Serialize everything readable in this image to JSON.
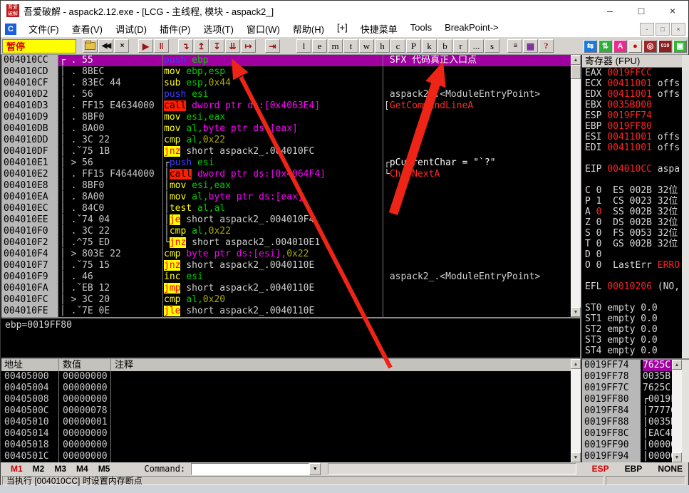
{
  "colors": {
    "selection_purple": "#a000a0",
    "value_red": "#ff2222",
    "pause_yellow": "#ffff00",
    "annotation_red": "#ee2417"
  },
  "window": {
    "title": "吾爱破解 - aspack2.12.exe - [LCG -  主线程, 模块 - aspack2_]",
    "controls": [
      "–",
      "□",
      "×"
    ]
  },
  "menu": {
    "items": [
      "文件(F)",
      "查看(V)",
      "调试(D)",
      "插件(P)",
      "选项(T)",
      "窗口(W)",
      "帮助(H)",
      "[+]",
      "快捷菜单",
      "Tools",
      "BreakPoint->"
    ],
    "mdi_controls": [
      "-",
      "□",
      "×"
    ]
  },
  "toolbar": {
    "pause_label": "暂停",
    "nav": [
      {
        "g": "",
        "cls": "b-folder"
      },
      {
        "g": "◀◀",
        "cls": "b-blk"
      },
      {
        "g": "×",
        "cls": "b-blk"
      },
      {
        "sp": 1
      },
      {
        "g": "▶",
        "cls": "b-red"
      },
      {
        "g": "‖",
        "cls": "b-red"
      },
      {
        "sp": 1
      },
      {
        "g": "↴",
        "cls": "b-red"
      },
      {
        "g": "↥",
        "cls": "b-red"
      },
      {
        "g": "↧",
        "cls": "b-red"
      },
      {
        "g": "⇊",
        "cls": "b-red"
      },
      {
        "g": "↦",
        "cls": "b-red"
      },
      {
        "sp": 1
      },
      {
        "g": "⇥",
        "cls": "b-red"
      },
      {
        "sp": 1
      }
    ],
    "letters": [
      "l",
      "e",
      "m",
      "t",
      "w",
      "h",
      "c",
      "P",
      "k",
      "b",
      "r",
      "...",
      "s"
    ],
    "tail": [
      {
        "g": "≡",
        "cls": "b-blk"
      },
      {
        "g": "▦",
        "cls": "b-pur"
      },
      {
        "g": "?",
        "cls": "b-q"
      }
    ],
    "right_icons": [
      {
        "name": "sync-icon",
        "g": "⇆",
        "bg": "#1f7ae0",
        "fg": "#fff"
      },
      {
        "name": "swap-icon",
        "g": "⇅",
        "bg": "#2fae3e",
        "fg": "#fff"
      },
      {
        "name": "a-icon",
        "g": "A",
        "bg": "#ee2a90",
        "fg": "#fff"
      },
      {
        "name": "record-icon",
        "g": "●",
        "bg": "#e8e4dc",
        "fg": "#d00000"
      },
      {
        "name": "target-icon",
        "g": "◎",
        "bg": "#a02828",
        "fg": "#fff"
      },
      {
        "name": "binary-icon",
        "g": "010",
        "bg": "#8a1f1f",
        "fg": "#fff"
      },
      {
        "name": "window-icon",
        "g": "▣",
        "bg": "#35b43a",
        "fg": "#fff"
      }
    ]
  },
  "disasm": {
    "rows": [
      {
        "a": "004010CC",
        "m": "┌ .",
        "h": "55",
        "o": [
          [
            "mB",
            "push"
          ],
          [
            "rG",
            " ebp"
          ]
        ],
        "c": [
          [
            "cw",
            " SFX 代码真正入口点"
          ]
        ],
        "s": 1
      },
      {
        "a": "004010CD",
        "m": "│ .",
        "h": "8BEC",
        "o": [
          [
            "mY",
            "mov"
          ],
          [
            "rG",
            " ebp,esp"
          ]
        ]
      },
      {
        "a": "004010CF",
        "m": "│ .",
        "h": "83EC 44",
        "o": [
          [
            "mY",
            "sub"
          ],
          [
            "rG",
            " esp,"
          ],
          [
            "iO",
            "0x44"
          ]
        ]
      },
      {
        "a": "004010D2",
        "m": "│ .",
        "h": "56",
        "o": [
          [
            "mB",
            "push"
          ],
          [
            "rG",
            " esi"
          ]
        ],
        "c": [
          [
            "tW",
            " aspack2_.<ModuleEntryPoint>"
          ]
        ]
      },
      {
        "a": "004010D3",
        "m": "│ .",
        "h": "FF15 E4634000",
        "o": [
          [
            "mC",
            "call"
          ],
          [
            "mM",
            " dword ptr ds:[0x4063E4]"
          ]
        ],
        "c": [
          [
            "tW",
            "["
          ],
          [
            "cr",
            "GetCommandLineA"
          ]
        ]
      },
      {
        "a": "004010D9",
        "m": "│ .",
        "h": "8BF0",
        "o": [
          [
            "mY",
            "mov"
          ],
          [
            "rG",
            " esi,eax"
          ]
        ]
      },
      {
        "a": "004010DB",
        "m": "│ .",
        "h": "8A00",
        "o": [
          [
            "mY",
            "mov"
          ],
          [
            "rG",
            " al,"
          ],
          [
            "mM",
            "byte ptr ds:[eax]"
          ]
        ]
      },
      {
        "a": "004010DD",
        "m": "│ .",
        "h": "3C 22",
        "o": [
          [
            "mY",
            "cmp"
          ],
          [
            "rG",
            " al,"
          ],
          [
            "iO",
            "0x22"
          ]
        ]
      },
      {
        "a": "004010DF",
        "m": "│ .ˇ",
        "h": "75 1B",
        "o": [
          [
            "mJ",
            "jnz"
          ],
          [
            "tW",
            " short aspack2_.004010FC"
          ]
        ]
      },
      {
        "a": "004010E1",
        "m": "│ >",
        "h": "56",
        "o": [
          [
            "tW",
            "┌"
          ],
          [
            "mB",
            "push"
          ],
          [
            "rG",
            " esi"
          ]
        ],
        "c": [
          [
            "tW",
            "┌"
          ],
          [
            "cw",
            "pCurrentChar = \"`?\""
          ]
        ]
      },
      {
        "a": "004010E2",
        "m": "│ .",
        "h": "FF15 F4644000",
        "o": [
          [
            "tW",
            "│"
          ],
          [
            "mC",
            "call"
          ],
          [
            "mM",
            " dword ptr ds:[0x4064F4]"
          ]
        ],
        "c": [
          [
            "tW",
            "└"
          ],
          [
            "cr",
            "CharNextA"
          ]
        ]
      },
      {
        "a": "004010E8",
        "m": "│ .",
        "h": "8BF0",
        "o": [
          [
            "tW",
            "│"
          ],
          [
            "mY",
            "mov"
          ],
          [
            "rG",
            " esi,eax"
          ]
        ]
      },
      {
        "a": "004010EA",
        "m": "│ .",
        "h": "8A00",
        "o": [
          [
            "tW",
            "│"
          ],
          [
            "mY",
            "mov"
          ],
          [
            "rG",
            " al,"
          ],
          [
            "mM",
            "byte ptr ds:[eax]"
          ]
        ]
      },
      {
        "a": "004010EC",
        "m": "│ .",
        "h": "84C0",
        "o": [
          [
            "tW",
            "│"
          ],
          [
            "mY",
            "test"
          ],
          [
            "rG",
            " al,al"
          ]
        ]
      },
      {
        "a": "004010EE",
        "m": "│ .ˇ",
        "h": "74 04",
        "o": [
          [
            "tW",
            "│"
          ],
          [
            "mJ",
            "je"
          ],
          [
            "tW",
            " short aspack2_.004010F4"
          ]
        ]
      },
      {
        "a": "004010F0",
        "m": "│ .",
        "h": "3C 22",
        "o": [
          [
            "tW",
            "│"
          ],
          [
            "mY",
            "cmp"
          ],
          [
            "rG",
            " al,"
          ],
          [
            "iO",
            "0x22"
          ]
        ]
      },
      {
        "a": "004010F2",
        "m": "│ .^",
        "h": "75 ED",
        "o": [
          [
            "tW",
            "└"
          ],
          [
            "mJ",
            "jnz"
          ],
          [
            "tW",
            " short aspack2_.004010E1"
          ]
        ]
      },
      {
        "a": "004010F4",
        "m": "│ >",
        "h": "803E 22",
        "o": [
          [
            "mY",
            "cmp"
          ],
          [
            "mM",
            " byte ptr ds:[esi],"
          ],
          [
            "iO",
            "0x22"
          ]
        ]
      },
      {
        "a": "004010F7",
        "m": "│ .ˇ",
        "h": "75 15",
        "o": [
          [
            "mJ",
            "jnz"
          ],
          [
            "tW",
            " short aspack2_.0040110E"
          ]
        ]
      },
      {
        "a": "004010F9",
        "m": "│ .",
        "h": "46",
        "o": [
          [
            "mY",
            "inc"
          ],
          [
            "rG",
            " esi"
          ]
        ],
        "c": [
          [
            "tW",
            " aspack2_.<ModuleEntryPoint>"
          ]
        ]
      },
      {
        "a": "004010FA",
        "m": "│ .ˇ",
        "h": "EB 12",
        "o": [
          [
            "mJ",
            "jmp"
          ],
          [
            "tW",
            " short aspack2_.0040110E"
          ]
        ]
      },
      {
        "a": "004010FC",
        "m": "│ >",
        "h": "3C 20",
        "o": [
          [
            "mY",
            "cmp"
          ],
          [
            "rG",
            " al,"
          ],
          [
            "iO",
            "0x20"
          ]
        ]
      },
      {
        "a": "004010FE",
        "m": "│ .ˇ",
        "h": "7E 0E",
        "o": [
          [
            "mJ",
            "jle"
          ],
          [
            "tW",
            " short aspack2_.0040110E"
          ]
        ]
      }
    ]
  },
  "regs": {
    "header": "寄存器 (FPU)",
    "lines": [
      [
        [
          "n",
          "EAX "
        ],
        [
          "v",
          "0019FFCC"
        ]
      ],
      [
        [
          "n",
          "ECX "
        ],
        [
          "v",
          "00411001"
        ],
        [
          "n",
          " offs"
        ]
      ],
      [
        [
          "n",
          "EDX "
        ],
        [
          "v",
          "00411001"
        ],
        [
          "n",
          " offs"
        ]
      ],
      [
        [
          "n",
          "EBX "
        ],
        [
          "v",
          "0035B000"
        ]
      ],
      [
        [
          "n",
          "ESP "
        ],
        [
          "v",
          "0019FF74"
        ]
      ],
      [
        [
          "n",
          "EBP "
        ],
        [
          "v",
          "0019FF80"
        ]
      ],
      [
        [
          "n",
          "ESI "
        ],
        [
          "v",
          "00411001"
        ],
        [
          "n",
          " offs"
        ]
      ],
      [
        [
          "n",
          "EDI "
        ],
        [
          "v",
          "00411001"
        ],
        [
          "n",
          " offs"
        ]
      ],
      [],
      [
        [
          "n",
          "EIP "
        ],
        [
          "v",
          "004010CC"
        ],
        [
          "n",
          " aspa"
        ]
      ],
      [],
      [
        [
          "n",
          "C 0  ES 002B 32位"
        ]
      ],
      [
        [
          "n",
          "P 1  CS 0023 32位"
        ]
      ],
      [
        [
          "n",
          "A "
        ],
        [
          "v",
          "0"
        ],
        [
          "n",
          "  SS 002B 32位"
        ]
      ],
      [
        [
          "n",
          "Z 0  DS 002B 32位"
        ]
      ],
      [
        [
          "n",
          "S 0  FS 0053 32位"
        ]
      ],
      [
        [
          "n",
          "T 0  GS 002B 32位"
        ]
      ],
      [
        [
          "n",
          "D 0"
        ]
      ],
      [
        [
          "n",
          "O 0  LastErr "
        ],
        [
          "v",
          "ERRO"
        ]
      ],
      [],
      [
        [
          "n",
          "EFL "
        ],
        [
          "v",
          "00010206"
        ],
        [
          "n",
          " (NO,"
        ]
      ],
      [],
      [
        [
          "n",
          "ST0 empty 0.0"
        ]
      ],
      [
        [
          "n",
          "ST1 empty 0.0"
        ]
      ],
      [
        [
          "n",
          "ST2 empty 0.0"
        ]
      ],
      [
        [
          "n",
          "ST3 empty 0.0"
        ]
      ],
      [
        [
          "n",
          "ST4 empty 0.0"
        ]
      ]
    ]
  },
  "stack": {
    "rows": [
      {
        "a": "0019FF74",
        "v": "7625C",
        "sel": 1
      },
      {
        "a": "0019FF78",
        "v": "0035B"
      },
      {
        "a": "0019FF7C",
        "v": "7625C"
      },
      {
        "a": "0019FF80",
        "v": "0019F",
        "f": "┌"
      },
      {
        "a": "0019FF84",
        "v": "77776",
        "f": "│"
      },
      {
        "a": "0019FF88",
        "v": "0035B",
        "f": "│"
      },
      {
        "a": "0019FF8C",
        "v": "EAC4B",
        "f": "│"
      },
      {
        "a": "0019FF90",
        "v": "00000",
        "f": "│"
      },
      {
        "a": "0019FF94",
        "v": "00000",
        "f": "│"
      }
    ]
  },
  "info": {
    "text": "ebp=0019FF80"
  },
  "dump": {
    "headers": [
      "地址",
      "数值",
      "注释"
    ],
    "rows": [
      {
        "a": "00405000",
        "v": "00000000"
      },
      {
        "a": "00405004",
        "v": "00000000"
      },
      {
        "a": "00405008",
        "v": "00000000"
      },
      {
        "a": "0040500C",
        "v": "00000078"
      },
      {
        "a": "00405010",
        "v": "00000001"
      },
      {
        "a": "00405014",
        "v": "00000000"
      },
      {
        "a": "00405018",
        "v": "00000000"
      },
      {
        "a": "0040501C",
        "v": "00000000"
      }
    ]
  },
  "cmdbar": {
    "tabs": [
      "M1",
      "M2",
      "M3",
      "M4",
      "M5"
    ],
    "active_tab": "M1",
    "command_label": "Command:",
    "command_value": "",
    "right_labels": [
      "ESP",
      "EBP",
      "NONE"
    ],
    "right_active": "ESP"
  },
  "status": {
    "text": "当执行 [004010CC] 时设置内存断点"
  }
}
